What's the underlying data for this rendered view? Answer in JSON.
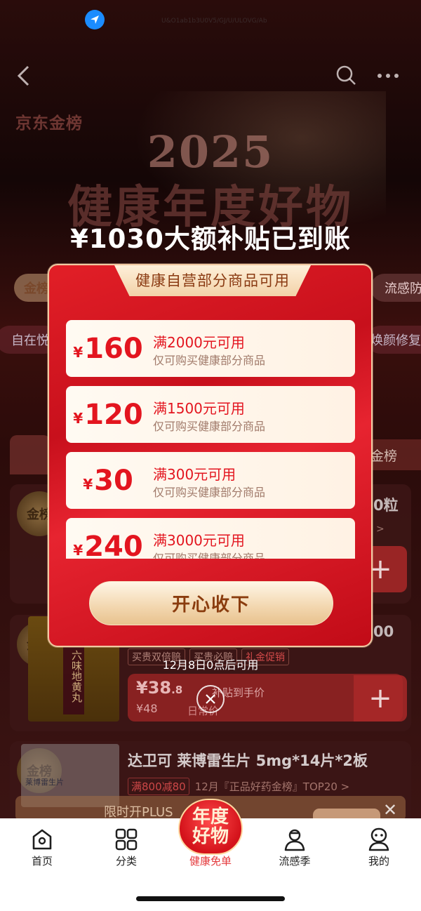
{
  "status": {
    "url_text": "U&O1ab1b3U0V5/GJ/U/ULOVG/Ab"
  },
  "header": {
    "brand": "京东金榜",
    "year": "2025",
    "title": "健康年度好物"
  },
  "background": {
    "pills": [
      "金榜",
      "流感防",
      "自在悦",
      "焕颜修复"
    ],
    "rank_right": "金榜",
    "card1": {
      "badge": "金榜",
      "peek_title": "0粒",
      "peek_sub": ">"
    },
    "card2": {
      "badge": "金榜",
      "product_text": "六味地黄丸",
      "peek_title": "00",
      "tags": [
        "买贵双倍赔",
        "买贵必赔",
        "礼金促销"
      ],
      "price": "¥38",
      "price_decimal": ".8",
      "price_note": "补贴到手价",
      "old_price": "¥48",
      "old_label": "日常价"
    },
    "card3": {
      "badge": "金榜",
      "img_text": "莱博雷生片",
      "title": "达卫可 莱博雷生片 5mg*14片*2板",
      "tag": "满800减80",
      "ranking": "12月『正品好药金榜』TOP20 >"
    },
    "plus_banner": "限时开PLUS"
  },
  "modal": {
    "heading": "¥1030大额补贴已到账",
    "ribbon": "健康自营部分商品可用",
    "currency": "¥",
    "coupons": [
      {
        "amount": "160",
        "condition": "满2000元可用",
        "desc": "仅可购买健康部分商品"
      },
      {
        "amount": "120",
        "condition": "满1500元可用",
        "desc": "仅可购买健康部分商品"
      },
      {
        "amount": "30",
        "condition": "满300元可用",
        "desc": "仅可购买健康部分商品"
      },
      {
        "amount": "240",
        "condition": "满3000元可用",
        "desc": "仅可购买健康部分商品"
      }
    ],
    "accept_label": "开心收下",
    "availability": "12月8日0点后可用"
  },
  "tabbar": {
    "items": [
      {
        "label": "首页",
        "icon": "home-icon"
      },
      {
        "label": "分类",
        "icon": "grid-icon"
      },
      {
        "label": "健康免单",
        "icon": "annual-goods-badge"
      },
      {
        "label": "流感季",
        "icon": "doctor-icon"
      },
      {
        "label": "我的",
        "icon": "profile-icon"
      }
    ],
    "center_badge": [
      "年度",
      "好物"
    ]
  },
  "colors": {
    "accent_red": "#e3151f",
    "modal_red": "#d5121c",
    "gold": "#f2d2a8",
    "tab_active": "#e4393c"
  }
}
